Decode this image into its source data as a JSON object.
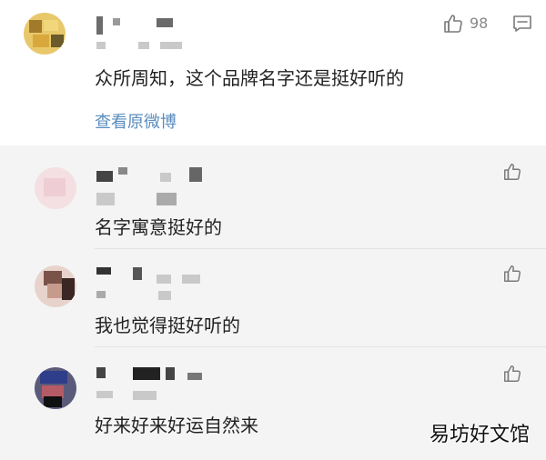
{
  "main_comment": {
    "text": "众所周知，这个品牌名字还是挺好听的",
    "like_count": "98",
    "view_original_label": "查看原微博",
    "like_icon": "thumbs-up-icon",
    "comment_icon": "comment-icon"
  },
  "replies": [
    {
      "text": "名字寓意挺好的",
      "like_icon": "thumbs-up-icon"
    },
    {
      "text": "我也觉得挺好听的",
      "like_icon": "thumbs-up-icon"
    },
    {
      "text": "好来好来好运自然来",
      "like_icon": "thumbs-up-icon"
    }
  ],
  "watermark": "易坊好文馆",
  "colors": {
    "link": "#5b8dbf",
    "reply_background": "#f4f4f4",
    "text": "#222222",
    "muted": "#888888"
  }
}
